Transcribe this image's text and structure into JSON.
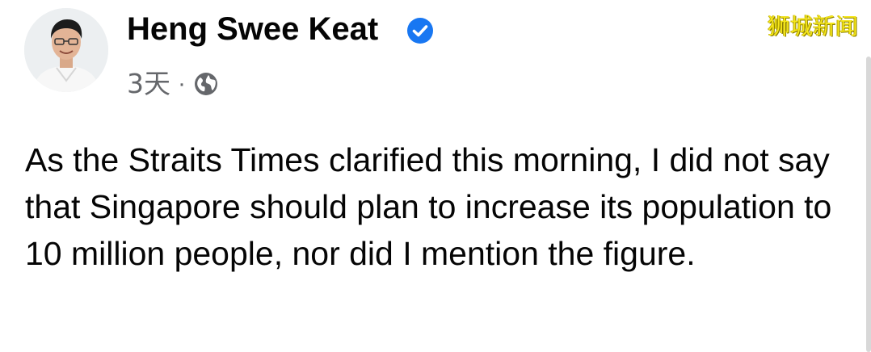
{
  "post": {
    "author": {
      "name": "Heng Swee Keat",
      "verified": true
    },
    "timestamp": "3天",
    "separator": "·",
    "audience_icon": "globe-icon",
    "text": "As the Straits Times clarified this morning, I did not say that Singapore should plan to increase its population to 10 million people, nor did I mention the figure."
  },
  "watermark": "狮城新闻",
  "colors": {
    "verified_badge": "#1877f2",
    "meta_text": "#65676b",
    "body_text": "#050505",
    "watermark": "#f5e61a"
  }
}
